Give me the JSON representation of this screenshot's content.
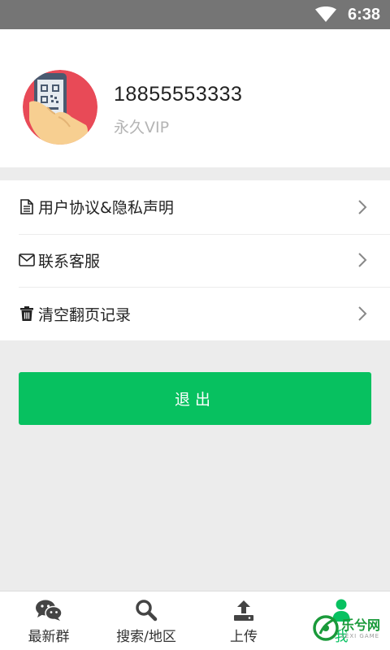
{
  "status_bar": {
    "time": "6:38",
    "icons": [
      "wifi-icon"
    ]
  },
  "profile": {
    "phone": "18855553333",
    "membership": "永久VIP",
    "avatar_icon": "qr-phone-hand-icon"
  },
  "menu": {
    "items": [
      {
        "label": "用户协议&隐私声明",
        "icon": "document-icon"
      },
      {
        "label": "联系客服",
        "icon": "mail-icon"
      },
      {
        "label": "清空翻页记录",
        "icon": "trash-icon"
      }
    ]
  },
  "logout": {
    "label": "退出",
    "color": "#07c160"
  },
  "bottom_nav": {
    "items": [
      {
        "label": "最新群",
        "icon": "wechat-icon"
      },
      {
        "label": "搜索/地区",
        "icon": "search-icon"
      },
      {
        "label": "上传",
        "icon": "upload-icon"
      },
      {
        "label": "我",
        "icon": "user-icon",
        "active": true
      }
    ]
  },
  "watermark": {
    "text": "乐兮网",
    "sub": "LEXI GAME"
  },
  "colors": {
    "accent": "#07c160",
    "status_bar": "#757575",
    "background": "#ececec"
  }
}
